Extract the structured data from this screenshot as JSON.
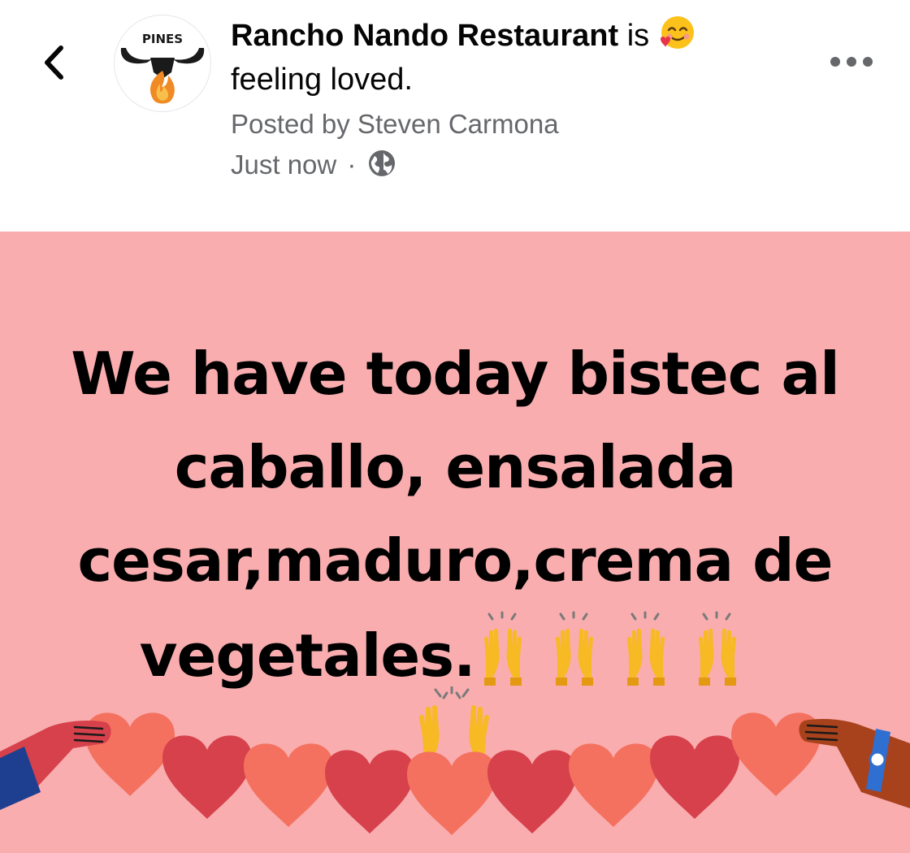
{
  "header": {
    "page_name": "Rancho Nando Restaurant",
    "feeling_prefix": "is",
    "feeling_text": "feeling loved.",
    "posted_by": "Posted by Steven Carmona",
    "timestamp": "Just now",
    "separator": "·",
    "avatar_logo_text": "PINES",
    "privacy_icon": "globe-icon",
    "back_icon": "chevron-left-icon",
    "more_icon": "more-horizontal-icon",
    "feeling_emoji": "smiling-face-with-hearts"
  },
  "post": {
    "background_color": "#f9adaf",
    "text": "We have today bistec al caballo, ensalada cesar,maduro,crema de vegetales.",
    "trailing_emoji": "raising-hands",
    "trailing_emoji_count": 4,
    "decoration": "hands-holding-hearts-chain"
  },
  "colors": {
    "primary_text": "#050505",
    "secondary_text": "#65676b",
    "heart_light": "#f4715f",
    "heart_dark": "#d6414b"
  }
}
